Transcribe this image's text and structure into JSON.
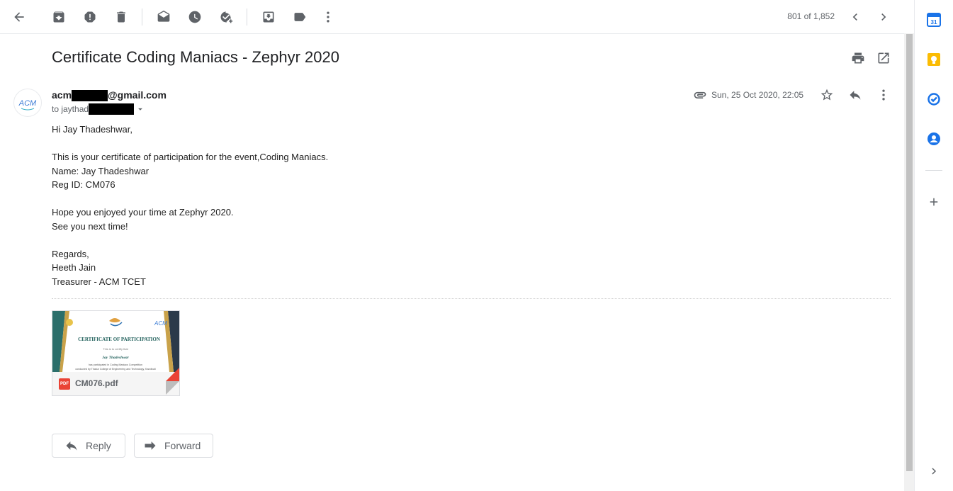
{
  "toolbar": {
    "counter": "801 of 1,852",
    "icons": [
      "back-icon",
      "archive-icon",
      "report-spam-icon",
      "delete-icon",
      "mark-unread-icon",
      "snooze-icon",
      "add-to-tasks-icon",
      "move-to-icon",
      "label-icon",
      "more-icon",
      "newer-icon",
      "older-icon"
    ]
  },
  "email": {
    "subject": "Certificate Coding Maniacs - Zephyr 2020",
    "sender_prefix": "acm",
    "sender_suffix": "@gmail.com",
    "to_prefix": "to jaythad",
    "date": "Sun, 25 Oct 2020, 22:05",
    "avatar_text": "ACM",
    "body": {
      "greeting": "Hi Jay Thadeshwar,",
      "line1": "This is your certificate of participation for the event,Coding Maniacs.",
      "line2": "Name: Jay Thadeshwar",
      "line3": "Reg ID: CM076",
      "line4": "Hope you enjoyed your time at Zephyr 2020.",
      "line5": "See you next time!",
      "regards": "Regards,",
      "name": "Heeth Jain",
      "role": "Treasurer - ACM TCET"
    }
  },
  "attachment": {
    "filename": "CM076.pdf",
    "badge": "PDF",
    "preview_title": "CERTIFICATE OF PARTICIPATION",
    "preview_line1": "This is to certify that",
    "preview_name": "Jay Thadeshwar",
    "preview_line2": "has participated in Coding Maniacs Competition",
    "preview_line3": "conducted by Thakur College of Engineering and Technology, Kandivali"
  },
  "actions": {
    "reply": "Reply",
    "forward": "Forward"
  },
  "side_panel": {
    "calendar_day": "31",
    "icons": [
      "calendar-icon",
      "keep-icon",
      "tasks-icon",
      "contacts-icon",
      "add-icon",
      "expand-panel-icon"
    ]
  },
  "colors": {
    "accent_blue": "#1a73e8",
    "keep_yellow": "#fbbc04",
    "pdf_red": "#ea4335"
  }
}
